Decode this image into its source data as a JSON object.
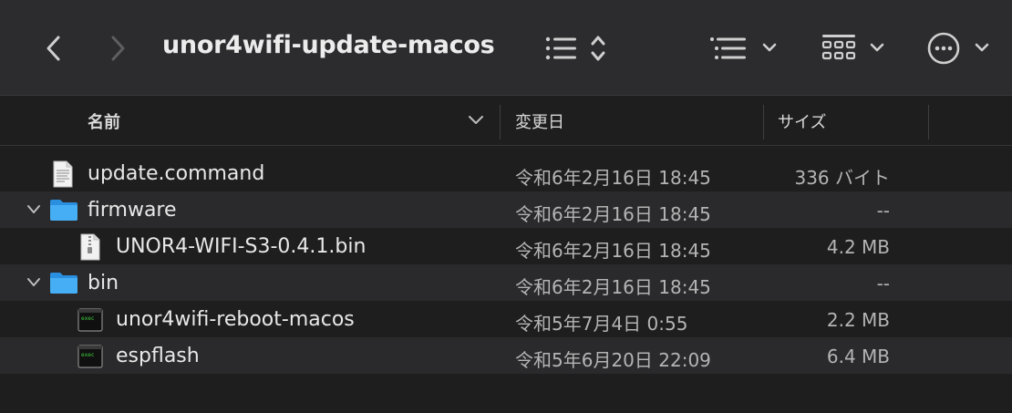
{
  "window": {
    "title": "unor4wifi-update-macos"
  },
  "toolbar": {
    "back_icon": "chevron-left-icon",
    "forward_icon": "chevron-right-icon",
    "sort_icon": "list-sort-icon",
    "list_view_icon": "list-view-icon",
    "grid_view_icon": "grid-view-icon",
    "more_icon": "ellipsis-circle-icon"
  },
  "columns": {
    "name": "名前",
    "date": "変更日",
    "size": "サイズ"
  },
  "files": [
    {
      "name": "update.command",
      "date": "令和6年2月16日 18:45",
      "size": "336 バイト",
      "icon": "document-icon"
    },
    {
      "name": "firmware",
      "date": "令和6年2月16日 18:45",
      "size": "--",
      "icon": "folder-icon"
    },
    {
      "name": "UNOR4-WIFI-S3-0.4.1.bin",
      "date": "令和6年2月16日 18:45",
      "size": "4.2 MB",
      "icon": "zip-file-icon"
    },
    {
      "name": "bin",
      "date": "令和6年2月16日 18:45",
      "size": "--",
      "icon": "folder-icon"
    },
    {
      "name": "unor4wifi-reboot-macos",
      "date": "令和5年7月4日 0:55",
      "size": "2.2 MB",
      "icon": "terminal-exec-icon"
    },
    {
      "name": "espflash",
      "date": "令和5年6月20日 22:09",
      "size": "6.4 MB",
      "icon": "terminal-exec-icon"
    }
  ],
  "colors": {
    "folder": "#3aa3f0",
    "background": "#1e1e1e",
    "toolbar": "#2c2c2e"
  }
}
